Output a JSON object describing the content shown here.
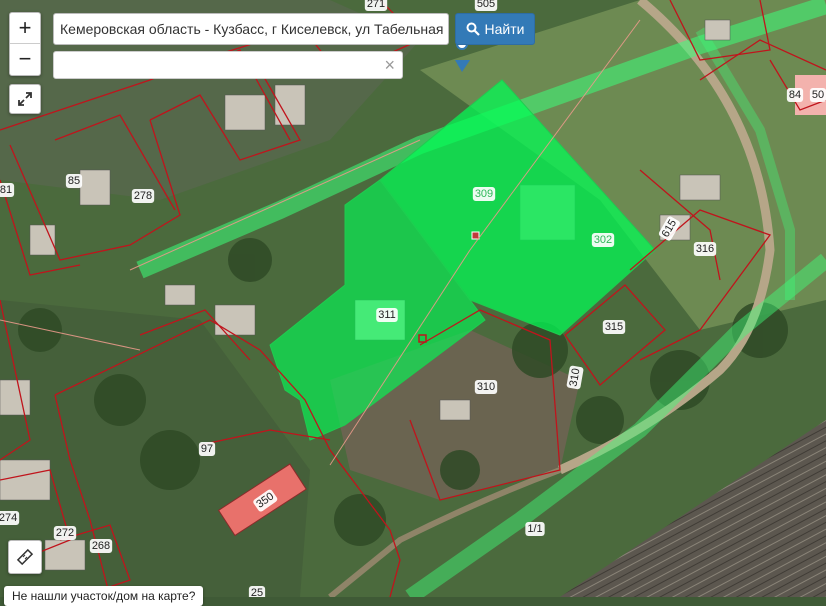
{
  "map": {
    "parcel_labels": [
      {
        "text": "271"
      },
      {
        "text": "505"
      },
      {
        "text": "84"
      },
      {
        "text": "50"
      },
      {
        "text": "85"
      },
      {
        "text": "81"
      },
      {
        "text": "278"
      },
      {
        "text": "309"
      },
      {
        "text": "302"
      },
      {
        "text": "316"
      },
      {
        "text": "615"
      },
      {
        "text": "311"
      },
      {
        "text": "315"
      },
      {
        "text": "310"
      },
      {
        "text": "310"
      },
      {
        "text": "97"
      },
      {
        "text": "350"
      },
      {
        "text": "274"
      },
      {
        "text": "272"
      },
      {
        "text": "268"
      },
      {
        "text": "1/1"
      },
      {
        "text": "25"
      }
    ],
    "colors": {
      "parcel_border": "#c0141c",
      "selected_fill": "#00ff55",
      "highlight_road": "#3dff7a",
      "building_fill": "#e8716b"
    }
  },
  "search": {
    "value": "Кемеровская область - Кузбасс, г Киселевск, ул Табельная",
    "button_label": "Найти",
    "second_value": ""
  },
  "controls": {
    "zoom_in": "+",
    "zoom_out": "−",
    "clear": "×"
  },
  "footer": {
    "link_text": "Не нашли участок/дом на карте?"
  }
}
